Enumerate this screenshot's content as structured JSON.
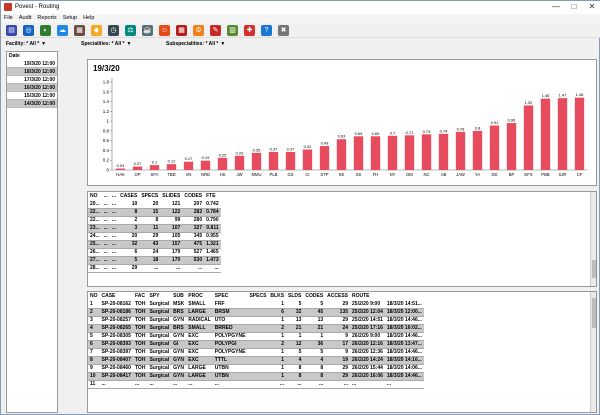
{
  "window": {
    "title": "Povest - Routing",
    "btn_min": "—",
    "btn_max": "□",
    "btn_close": "✕"
  },
  "menu": [
    "File",
    "Audit",
    "Reports",
    "Setup",
    "Help"
  ],
  "toolbar": [
    {
      "name": "report-icon",
      "color": "#3949ab",
      "glyph": "▤"
    },
    {
      "name": "globe-icon",
      "color": "#1565c0",
      "glyph": "◎"
    },
    {
      "name": "chart-icon",
      "color": "#2e7d32",
      "glyph": "◐"
    },
    {
      "name": "cloud-icon",
      "color": "#1e88e5",
      "glyph": "☁"
    },
    {
      "name": "clipboard-icon",
      "color": "#6d4c41",
      "glyph": "▦"
    },
    {
      "name": "route-sign-icon",
      "color": "#f9a825",
      "glyph": "◆"
    },
    {
      "name": "clock-icon",
      "color": "#37474f",
      "glyph": "◷"
    },
    {
      "name": "scale-icon",
      "color": "#00897b",
      "glyph": "⚖"
    },
    {
      "name": "teapot-icon",
      "color": "#546e7a",
      "glyph": "☕"
    },
    {
      "name": "person-icon",
      "color": "#e64a19",
      "glyph": "☺"
    },
    {
      "name": "grid-icon",
      "color": "#b71c1c",
      "glyph": "▦"
    },
    {
      "name": "gear-icon",
      "color": "#f57f17",
      "glyph": "⚙"
    },
    {
      "name": "wrench-icon",
      "color": "#c62828",
      "glyph": "✎"
    },
    {
      "name": "book-icon",
      "color": "#558b2f",
      "glyph": "▥"
    },
    {
      "name": "lifebuoy-icon",
      "color": "#d32f2f",
      "glyph": "✚"
    },
    {
      "name": "help-icon",
      "color": "#1976d2",
      "glyph": "?"
    },
    {
      "name": "close-icon",
      "color": "#757575",
      "glyph": "✖"
    }
  ],
  "filters": {
    "facility_label": "Facility:",
    "facility_value": "* All *",
    "specialities_label": "Specialities:",
    "specialities_value": "* All *",
    "subspecialities_label": "Subspecialities:",
    "subspecialities_value": "* All *"
  },
  "dates": {
    "header": "Date",
    "rows": [
      "19/3/20 12:00",
      "18/3/20 12:00",
      "17/3/20 12:00",
      "16/3/20 12:00",
      "15/3/20 12:00",
      "14/3/20 12:00"
    ]
  },
  "chart_data": {
    "type": "bar",
    "title": "19/3/20",
    "categories": [
      "HAK",
      "OP",
      "SFA",
      "TBD",
      "VN",
      "NRD",
      "HS",
      "JW",
      "MMU",
      "PLB",
      "GS",
      "CI",
      "STP",
      "KE",
      "SS",
      "FH",
      "NY",
      "DM",
      "NC",
      "AB",
      "JAW",
      "YA",
      "DD",
      "BP",
      "EFS",
      "PBB",
      "SJR",
      "CF"
    ],
    "values": [
      0.03,
      0.07,
      0.1,
      0.12,
      0.17,
      0.19,
      0.25,
      0.29,
      0.35,
      0.37,
      0.37,
      0.42,
      0.49,
      0.63,
      0.69,
      0.69,
      0.7,
      0.71,
      0.73,
      0.74,
      0.78,
      0.8,
      0.91,
      0.96,
      1.32,
      1.46,
      1.47,
      1.48
    ],
    "value_labels": [
      "0.03",
      "0.07",
      "0.1",
      "0.12",
      "0.17",
      "0.19",
      "0.25",
      "0.29",
      "0.35",
      "0.37",
      "0.37",
      "0.42",
      "0.49",
      "0.63",
      "0.69",
      "0.69",
      "0.7",
      "0.71",
      "0.73",
      "0.74",
      "0.78",
      "0.8",
      "0.91",
      "0.96",
      "1.32",
      "1.46",
      "1.47",
      "1.48"
    ],
    "yticks": [
      "0",
      "0.2",
      "0.4",
      "0.6",
      "0.8",
      "1",
      "1.2",
      "1.4",
      "1.6",
      "1.8"
    ],
    "ylim": [
      0,
      1.8
    ],
    "bar_color": "#e74c5e"
  },
  "cases_table": {
    "headers": [
      "NO",
      "...",
      "...",
      "CASES",
      "SPECS",
      "SLIDES",
      "CODES",
      "FTE"
    ],
    "rows": [
      [
        "20...",
        "...",
        "...",
        "10",
        "20",
        "121",
        "207",
        "0.742"
      ],
      [
        "22...",
        "...",
        "...",
        "8",
        "15",
        "122",
        "282",
        "0.784"
      ],
      [
        "22...",
        "...",
        "...",
        "2",
        "8",
        "99",
        "280",
        "0.790"
      ],
      [
        "23...",
        "...",
        "...",
        "3",
        "11",
        "107",
        "327",
        "0.811"
      ],
      [
        "24...",
        "...",
        "...",
        "20",
        "29",
        "105",
        "345",
        "0.955"
      ],
      [
        "25...",
        "...",
        "...",
        "32",
        "43",
        "157",
        "475",
        "1.321"
      ],
      [
        "26...",
        "...",
        "...",
        "6",
        "24",
        "179",
        "527",
        "1.465"
      ],
      [
        "27...",
        "...",
        "...",
        "5",
        "18",
        "170",
        "530",
        "1.473"
      ],
      [
        "28...",
        "...",
        "...",
        "29",
        "...",
        "...",
        "...",
        "..."
      ]
    ]
  },
  "access_table": {
    "headers": [
      "NO",
      "CASE",
      "FAC",
      "SPY",
      "SUB",
      "PROC",
      "SPEC",
      "SPECS",
      "BLKS",
      "SLDS",
      "CODES",
      "ACCESS",
      "ROUTE"
    ],
    "rows": [
      [
        "1",
        "SP-20-08162",
        "TOH",
        "Surgical",
        "MSK",
        "SMALL",
        "FRF",
        "",
        "1",
        "5",
        "5",
        "29",
        "25/2/20 9:00",
        "18/3/20 14:51..."
      ],
      [
        "2",
        "SP-20-08186",
        "TOH",
        "Surgical",
        "BRS",
        "LARGE",
        "BRSM",
        "",
        "6",
        "32",
        "45",
        "135",
        "25/2/20 12:04",
        "18/3/20 12:00..."
      ],
      [
        "3",
        "SP-20-08257",
        "TOH",
        "Surgical",
        "GYN",
        "RADICAL",
        "UTO",
        "",
        "1",
        "13",
        "13",
        "29",
        "25/2/20 14:51",
        "18/3/20 14:46..."
      ],
      [
        "4",
        "SP-20-08265",
        "TOH",
        "Surgical",
        "BRS",
        "SMALL",
        "BRRED",
        "",
        "2",
        "21",
        "21",
        "24",
        "25/2/20 17:16",
        "18/3/20 16:02..."
      ],
      [
        "5",
        "SP-20-08305",
        "TOH",
        "Surgical",
        "GYN",
        "EXC",
        "POLYPGYNE",
        "",
        "1",
        "1",
        "1",
        "9",
        "26/2/20 9:00",
        "18/3/20 14:46..."
      ],
      [
        "6",
        "SP-20-08393",
        "TOH",
        "Surgical",
        "GI",
        "EXC",
        "POLYPGI",
        "",
        "2",
        "12",
        "36",
        "17",
        "26/2/20 12:16",
        "18/3/20 13:47..."
      ],
      [
        "7",
        "SP-20-08397",
        "TOH",
        "Surgical",
        "GYN",
        "EXC",
        "POLYPGYNE",
        "",
        "1",
        "5",
        "5",
        "9",
        "26/2/20 12:36",
        "18/3/20 14:46..."
      ],
      [
        "8",
        "SP-20-08407",
        "TOH",
        "Surgical",
        "GYN",
        "EXC",
        "TTTL",
        "",
        "1",
        "4",
        "4",
        "19",
        "26/2/20 14:24",
        "18/3/20 14:16..."
      ],
      [
        "9",
        "SP-20-08460",
        "TOH",
        "Surgical",
        "GYN",
        "LARGE",
        "UTBN",
        "",
        "1",
        "8",
        "8",
        "29",
        "26/2/20 15:44",
        "18/3/20 14:06..."
      ],
      [
        "10",
        "SP-20-08417",
        "TOH",
        "Surgical",
        "GYN",
        "LARGE",
        "UTBN",
        "",
        "1",
        "8",
        "8",
        "29",
        "26/2/20 16:06",
        "18/3/20 14:46..."
      ],
      [
        "11",
        "...",
        "...",
        "...",
        "...",
        "...",
        "...",
        "",
        "...",
        "...",
        "...",
        "...",
        "...",
        "..."
      ]
    ]
  }
}
